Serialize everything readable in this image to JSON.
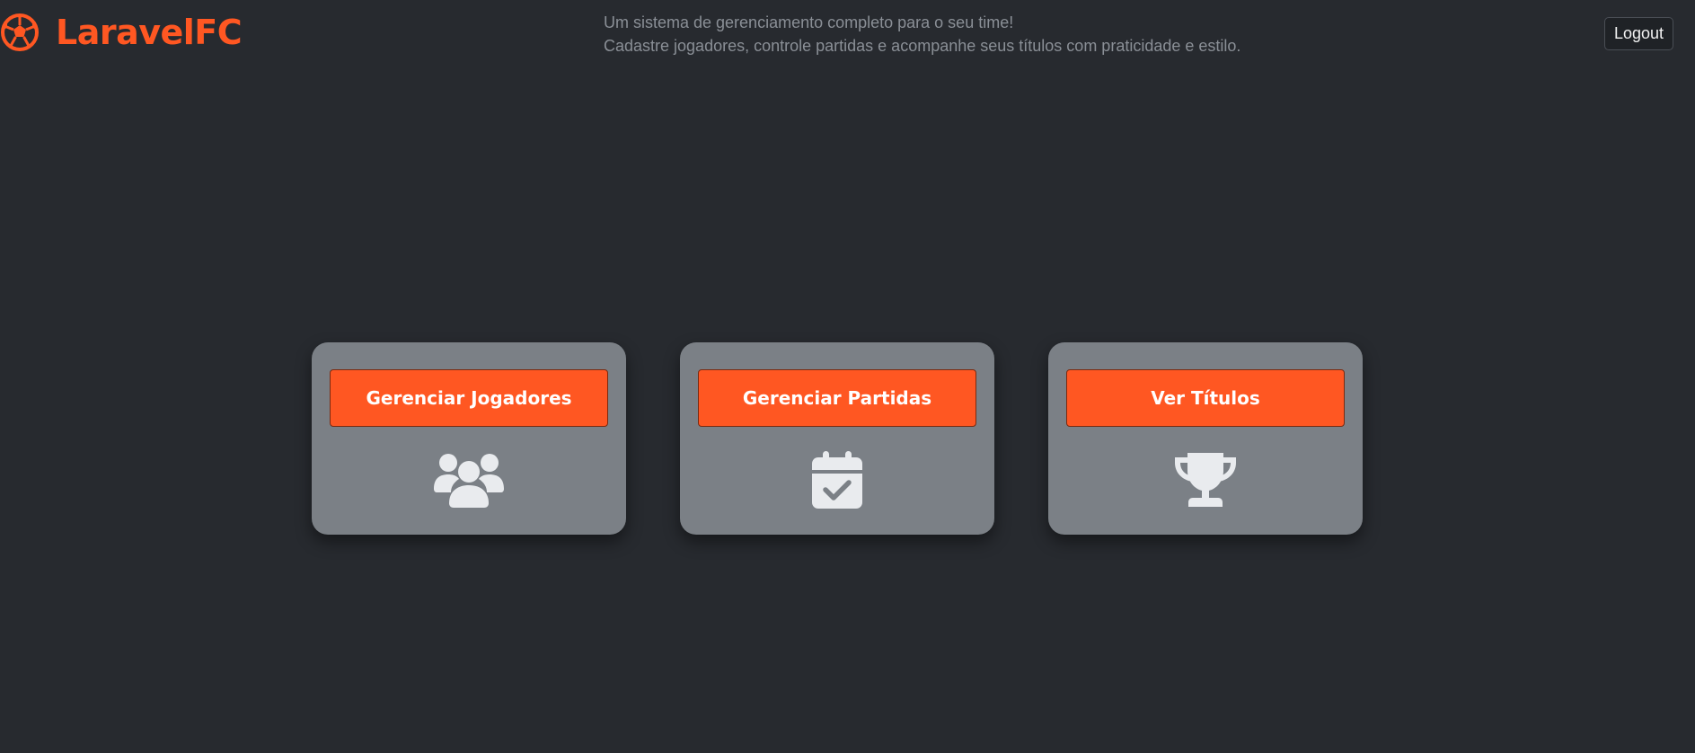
{
  "brand": {
    "name": "LaravelFC",
    "icon": "soccer-ball-icon",
    "color": "#ff5722"
  },
  "tagline": {
    "line1": "Um sistema de gerenciamento completo para o seu time!",
    "line2": "Cadastre jogadores, controle partidas e acompanhe seus títulos com praticidade e estilo."
  },
  "header": {
    "logout_label": "Logout"
  },
  "cards": [
    {
      "label": "Gerenciar Jogadores",
      "icon": "users-icon"
    },
    {
      "label": "Gerenciar Partidas",
      "icon": "calendar-check-icon"
    },
    {
      "label": "Ver Títulos",
      "icon": "trophy-icon"
    }
  ],
  "colors": {
    "background": "#272a2f",
    "card": "#7b8086",
    "accent": "#ff5722",
    "icon": "#e9ebee"
  }
}
